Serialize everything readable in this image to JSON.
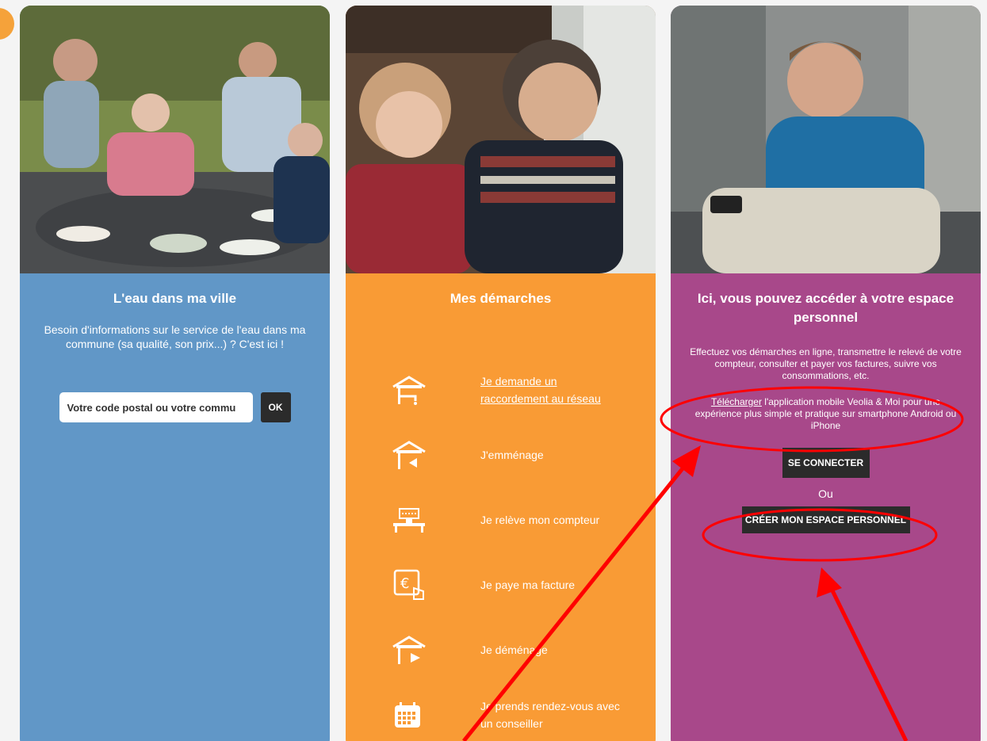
{
  "card_water": {
    "title": "L'eau dans ma ville",
    "description": "Besoin d'informations sur le service de l'eau dans ma commune (sa qualité, son prix...) ? C'est ici !",
    "search_value": "Votre code postal ou votre commu",
    "ok_label": "OK",
    "color": "#6197c7"
  },
  "card_steps": {
    "title": "Mes démarches",
    "color": "#f99b35",
    "items": [
      {
        "label": "Je demande un raccordement au réseau",
        "icon": "house-tap-icon"
      },
      {
        "label": "J'emménage",
        "icon": "house-arrow-in-icon"
      },
      {
        "label": "Je relève mon compteur",
        "icon": "water-meter-icon"
      },
      {
        "label": "Je paye ma facture",
        "icon": "payment-tablet-icon"
      },
      {
        "label": "Je déménage",
        "icon": "house-arrow-out-icon"
      },
      {
        "label": "Je prends rendez-vous avec un conseiller",
        "icon": "calendar-icon"
      }
    ]
  },
  "card_account": {
    "title": "Ici, vous pouvez accéder à votre espace personnel",
    "description": "Effectuez vos démarches en ligne, transmettre le relevé de votre compteur, consulter et payer vos factures, suivre vos consommations, etc.",
    "download_link": "Télécharger",
    "download_text": " l'application mobile Veolia & Moi pour une expérience plus simple et pratique sur smartphone Android ou iPhone",
    "connect_label": "SE CONNECTER",
    "or_label": "Ou",
    "create_label": "CRÉER MON ESPACE PERSONNEL",
    "color": "#a8488a"
  },
  "annotation_color": "#ff0000"
}
